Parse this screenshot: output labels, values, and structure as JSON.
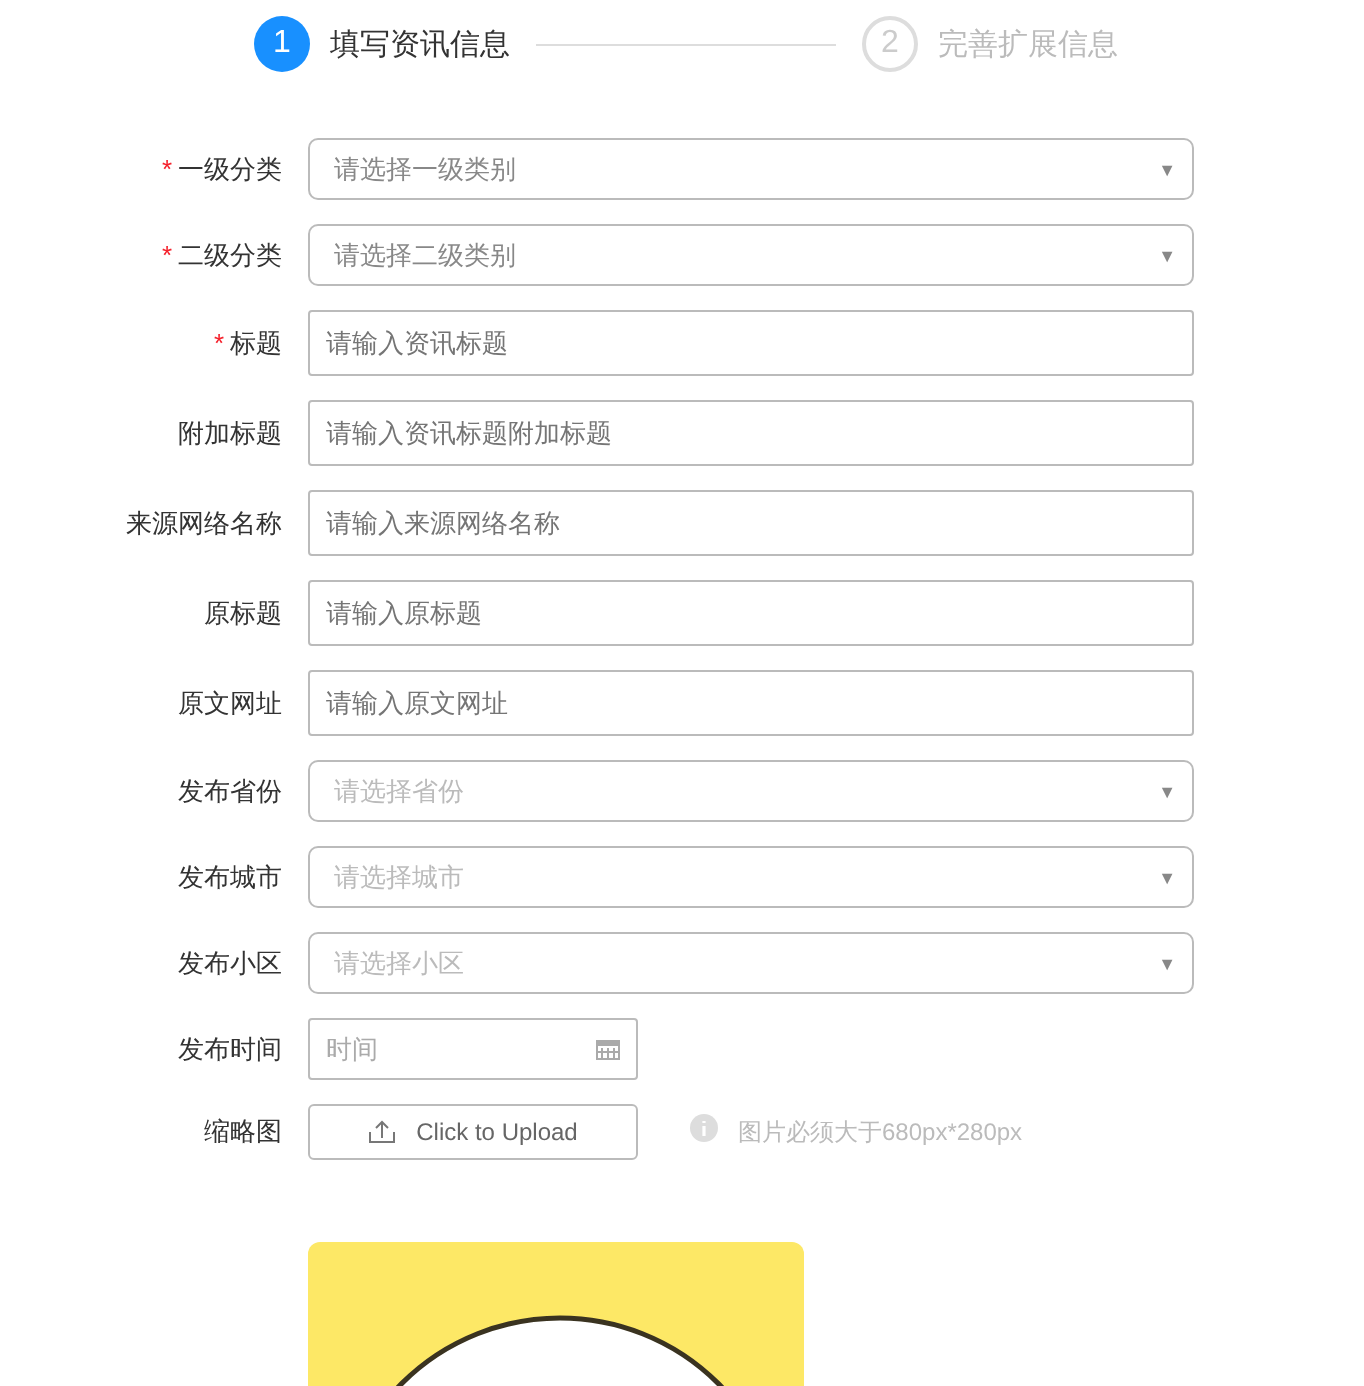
{
  "steps": [
    {
      "number": "1",
      "label": "填写资讯信息",
      "selected": true
    },
    {
      "number": "2",
      "label": "完善扩展信息",
      "selected": false
    }
  ],
  "form": [
    {
      "kind": "select",
      "required_mark": "*",
      "label": "一级分类",
      "placeholder": "请选择一级类别",
      "caret": "▼"
    },
    {
      "kind": "select",
      "required_mark": "*",
      "label": "二级分类",
      "placeholder": "请选择二级类别",
      "caret": "▼"
    },
    {
      "kind": "input",
      "required_mark": "*",
      "label": "标题",
      "placeholder": "请输入资讯标题"
    },
    {
      "kind": "input",
      "label": "附加标题",
      "placeholder": "请输入资讯标题附加标题"
    },
    {
      "kind": "input",
      "label": "来源网络名称",
      "placeholder": "请输入来源网络名称"
    },
    {
      "kind": "input",
      "label": "原标题",
      "placeholder": "请输入原标题"
    },
    {
      "kind": "input",
      "label": "原文网址",
      "placeholder": "请输入原文网址"
    },
    {
      "kind": "select",
      "label": "发布省份",
      "placeholder": "请选择省份",
      "caret": "▼"
    },
    {
      "kind": "select",
      "label": "发布城市",
      "placeholder": "请选择城市",
      "caret": "▼"
    },
    {
      "kind": "select",
      "label": "发布小区",
      "placeholder": "请选择小区",
      "caret": "▼"
    },
    {
      "kind": "date",
      "label": "发布时间",
      "placeholder": "时间"
    },
    {
      "kind": "upload",
      "label": "缩略图",
      "button": "Click to Upload",
      "hint": "图片必须大于680px*280px"
    }
  ]
}
